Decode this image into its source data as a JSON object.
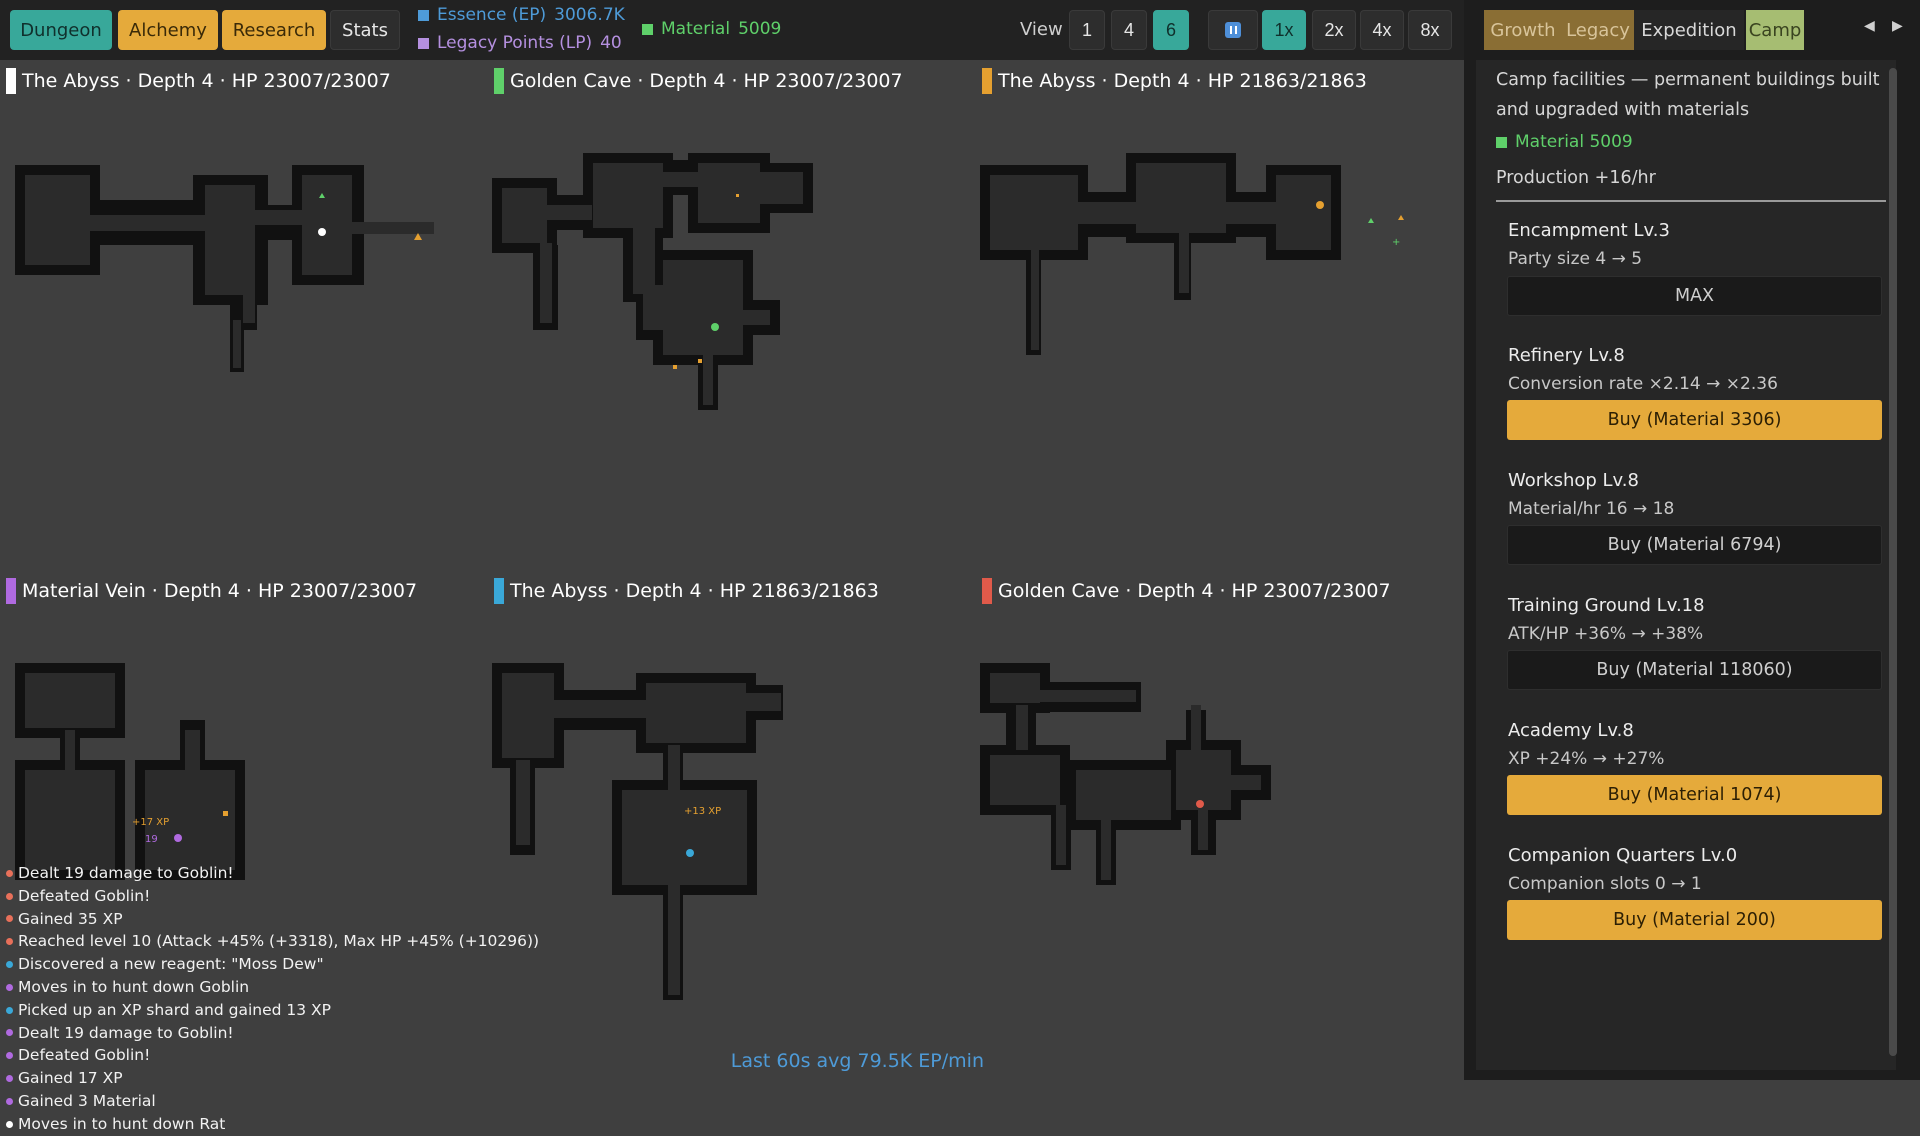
{
  "topbar": {
    "nav": [
      {
        "label": "Dungeon",
        "style": "teal"
      },
      {
        "label": "Alchemy",
        "style": "gold"
      },
      {
        "label": "Research",
        "style": "gold"
      },
      {
        "label": "Stats",
        "style": "dark"
      }
    ],
    "resources": {
      "essence_label": "Essence (EP)",
      "essence_value": "3006.7K",
      "essence_color": "#4e9bd8",
      "legacy_label": "Legacy Points (LP)",
      "legacy_value": "40",
      "legacy_color": "#b590e0",
      "material_label": "Material",
      "material_value": "5009",
      "material_color": "#5fd06a"
    },
    "view_label": "View",
    "view_options": [
      "1",
      "4",
      "6"
    ],
    "view_selected": "6",
    "pause_icon": "pause-icon",
    "speeds": [
      "1x",
      "2x",
      "4x",
      "8x"
    ],
    "speed_selected": "1x"
  },
  "dungeons": [
    {
      "title": "The Abyss · Depth 4 · HP 23007/23007",
      "color": "#ffffff"
    },
    {
      "title": "Golden Cave · Depth 4 · HP 23007/23007",
      "color": "#5fd06a"
    },
    {
      "title": "The Abyss · Depth 4 · HP 21863/21863",
      "color": "#e5a030"
    },
    {
      "title": "Material Vein · Depth 4 · HP 23007/23007",
      "color": "#b06ae0"
    },
    {
      "title": "The Abyss · Depth 4 · HP 21863/21863",
      "color": "#3aa8d8"
    },
    {
      "title": "Golden Cave · Depth 4 · HP 23007/23007",
      "color": "#e05a4a"
    }
  ],
  "floating_texts": {
    "d4_xp": "+17 XP",
    "d4_dmg": "19",
    "d5_xp": "+13 XP"
  },
  "log": [
    {
      "text": "Dealt 19 damage to Goblin!",
      "color": "#e8705a"
    },
    {
      "text": "Defeated Goblin!",
      "color": "#e8705a"
    },
    {
      "text": "Gained 35 XP",
      "color": "#e8705a"
    },
    {
      "text": "Reached level 10 (Attack +45% (+3318), Max HP +45% (+10296))",
      "color": "#e8705a"
    },
    {
      "text": "Discovered a new reagent: \"Moss Dew\"",
      "color": "#3aa8d8"
    },
    {
      "text": "Moves in to hunt down Goblin",
      "color": "#b06ae0"
    },
    {
      "text": "Picked up an XP shard and gained 13 XP",
      "color": "#3aa8d8"
    },
    {
      "text": "Dealt 19 damage to Goblin!",
      "color": "#b06ae0"
    },
    {
      "text": "Defeated Goblin!",
      "color": "#b06ae0"
    },
    {
      "text": "Gained 17 XP",
      "color": "#b06ae0"
    },
    {
      "text": "Gained 3 Material",
      "color": "#b06ae0"
    },
    {
      "text": "Moves in to hunt down Rat",
      "color": "#ffffff"
    }
  ],
  "avg_rate": "Last 60s avg 79.5K EP/min",
  "panel": {
    "tabs": [
      {
        "label": "Growth",
        "style": "gold"
      },
      {
        "label": "Legacy",
        "style": "gold"
      },
      {
        "label": "Expedition",
        "style": "plain"
      },
      {
        "label": "Camp",
        "style": "on"
      }
    ],
    "arrow_left": "◀",
    "arrow_right": "▶",
    "description_1": "Camp facilities — permanent buildings built",
    "description_2": "and upgraded with materials",
    "material_label": "Material 5009",
    "production": "Production +16/hr",
    "facilities": [
      {
        "name": "Encampment Lv.3",
        "effect": "Party size 4 → 5",
        "button": "MAX",
        "style": "dark"
      },
      {
        "name": "Refinery Lv.8",
        "effect": "Conversion rate ×2.14 → ×2.36",
        "button": "Buy (Material 3306)",
        "style": "gold"
      },
      {
        "name": "Workshop Lv.8",
        "effect": "Material/hr 16 → 18",
        "button": "Buy (Material 6794)",
        "style": "dark"
      },
      {
        "name": "Training Ground Lv.18",
        "effect": "ATK/HP +36% → +38%",
        "button": "Buy (Material 118060)",
        "style": "dark"
      },
      {
        "name": "Academy Lv.8",
        "effect": "XP +24% → +27%",
        "button": "Buy (Material 1074)",
        "style": "gold"
      },
      {
        "name": "Companion Quarters Lv.0",
        "effect": "Companion slots 0 → 1",
        "button": "Buy (Material 200)",
        "style": "gold"
      }
    ]
  }
}
